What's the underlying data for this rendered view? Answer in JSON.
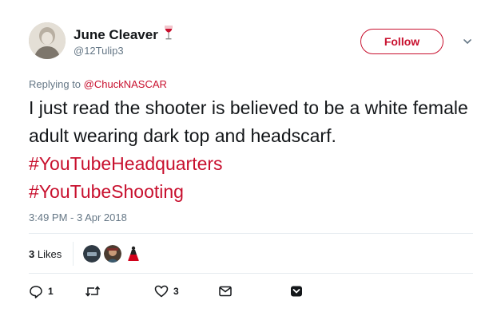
{
  "author": {
    "display_name": "June Cleaver",
    "handle": "@12Tulip3",
    "name_emoji": "wine-glass-icon"
  },
  "follow_button": {
    "label": "Follow"
  },
  "reply_context": {
    "prefix": "Replying to",
    "mention": "@ChuckNASCAR"
  },
  "tweet": {
    "text_plain": "I just read the shooter is believed to be a white female adult wearing dark top and headscarf.",
    "hashtags": [
      "#YouTubeHeadquarters",
      "#YouTubeShooting"
    ],
    "timestamp": "3:49 PM - 3 Apr 2018"
  },
  "likes": {
    "count": "3",
    "label": "Likes",
    "likers": [
      "liker-avatar-1",
      "liker-avatar-2",
      "liker-avatar-3"
    ]
  },
  "actions": {
    "reply_count": "1",
    "retweet_count": "",
    "like_count": "3"
  },
  "colors": {
    "accent": "#c8102e",
    "muted": "#657786",
    "text": "#14171a"
  }
}
